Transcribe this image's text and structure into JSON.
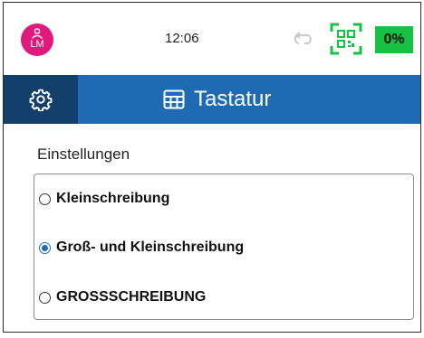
{
  "status_bar": {
    "avatar_initials": "LM",
    "time": "12:06",
    "battery": "0%",
    "icons": [
      "person-icon",
      "sync-icon",
      "qr-code-icon"
    ],
    "colors": {
      "avatar": "#e0197c",
      "qr": "#16c241",
      "battery": "#16c241"
    }
  },
  "header": {
    "title": "Tastatur",
    "icons": [
      "gear-icon",
      "keyboard-icon"
    ],
    "colors": {
      "bar": "#1f6bb3",
      "settings_button": "#133f6b"
    }
  },
  "settings": {
    "label": "Einstellungen",
    "options": [
      {
        "label": "Kleinschreibung",
        "selected": false
      },
      {
        "label": "Groß- und Kleinschreibung",
        "selected": true
      },
      {
        "label": "GROSSSCHREIBUNG",
        "selected": false
      }
    ]
  }
}
